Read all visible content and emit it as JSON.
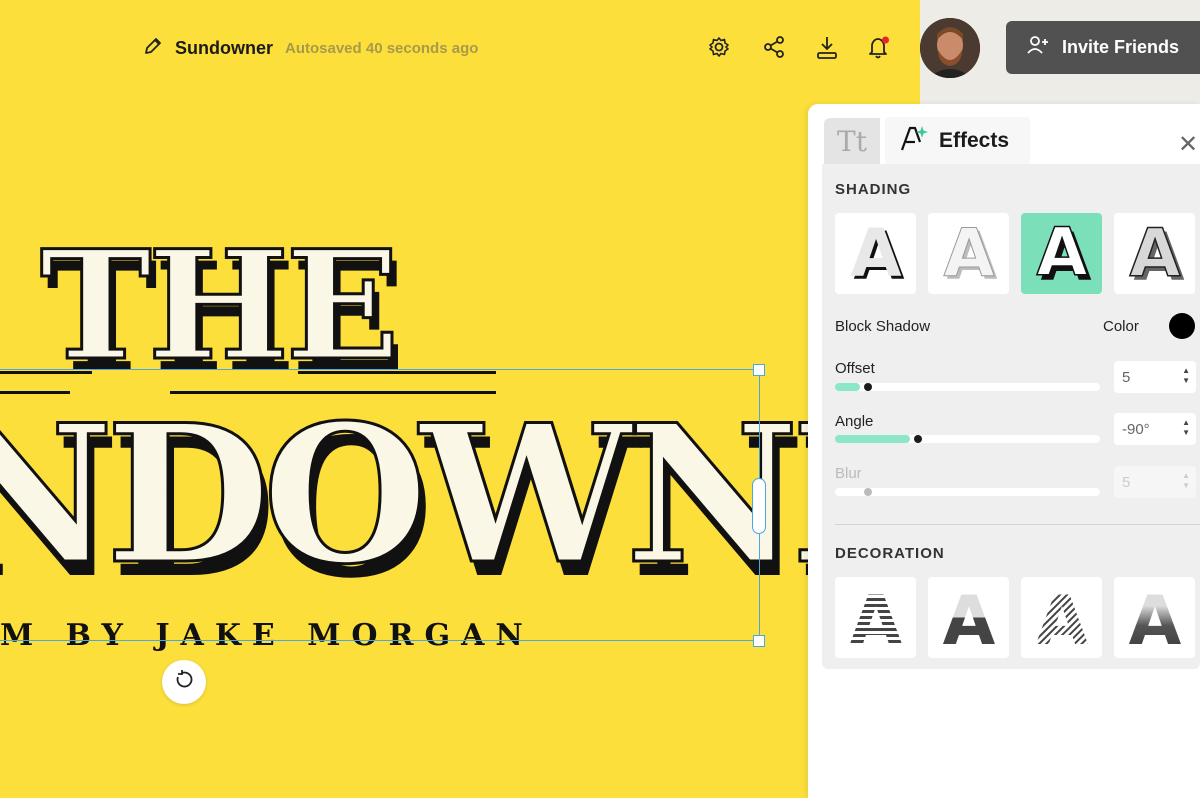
{
  "doc": {
    "title": "Sundowner",
    "autosave": "Autosaved 40 seconds ago"
  },
  "header": {
    "invite_label": "Invite Friends"
  },
  "canvas": {
    "title_line1": "THE",
    "title_line2": "NDOWNER",
    "subtitle": "M BY JAKE MORGAN"
  },
  "panel": {
    "tab_text_label": "Tt",
    "tab_effects_label": "Effects",
    "shading_heading": "SHADING",
    "shading_options": [
      "A",
      "A",
      "A",
      "A"
    ],
    "shading_selected_index": 2,
    "block_shadow_label": "Block Shadow",
    "color_label": "Color",
    "shadow_color": "#000000",
    "offset": {
      "label": "Offset",
      "value": "5",
      "slider_fraction": 0.07
    },
    "angle": {
      "label": "Angle",
      "value": "-90°",
      "slider_fraction": 0.26
    },
    "blur": {
      "label": "Blur",
      "value": "5",
      "slider_fraction": 0.07,
      "disabled": true
    },
    "decoration_heading": "DECORATION",
    "decoration_options": [
      "A",
      "A",
      "A",
      "A"
    ]
  },
  "colors": {
    "canvas_bg": "#fcdf3b",
    "accent": "#7be0b9",
    "selection": "#4aa7e0"
  },
  "icons": [
    "pencil-icon",
    "gear-icon",
    "share-icon",
    "download-icon",
    "bell-icon",
    "add-user-icon",
    "close-icon",
    "rotate-icon",
    "effects-icon"
  ]
}
